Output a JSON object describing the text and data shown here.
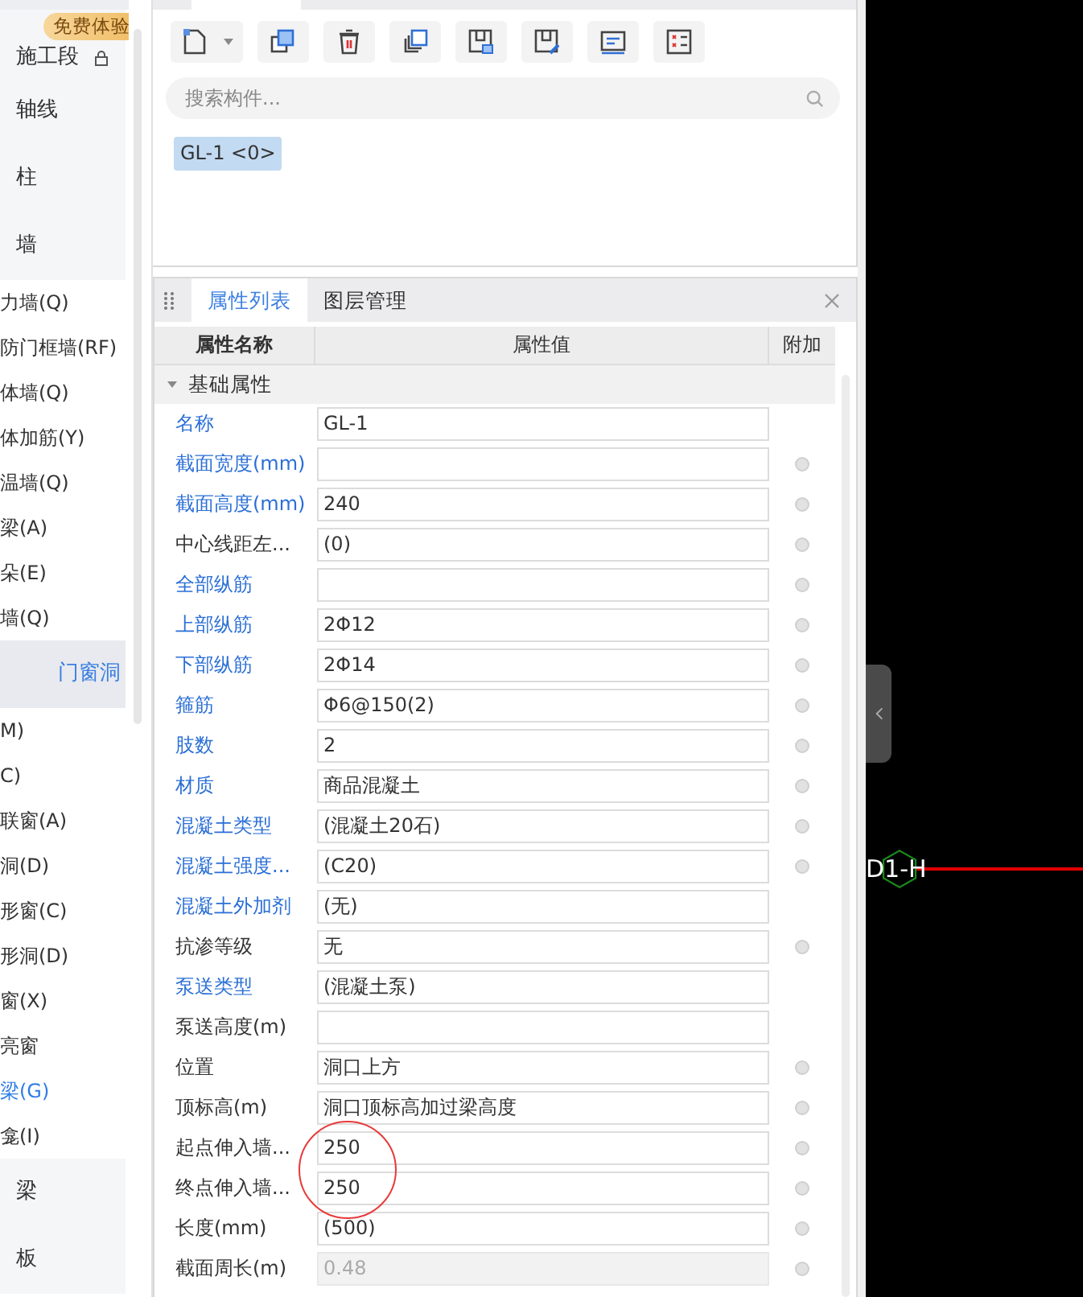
{
  "sidebar": {
    "badge": "免费体验",
    "items": [
      {
        "label": "施工段",
        "selected": false,
        "locked": true
      },
      {
        "label": "轴线",
        "selected": false
      },
      {
        "label": "柱",
        "selected": false
      },
      {
        "label": "墙",
        "selected": false,
        "children": [
          {
            "label": "力墙(Q)",
            "selected": false
          },
          {
            "label": "防门框墙(RF)",
            "selected": false
          },
          {
            "label": "体墙(Q)",
            "selected": false
          },
          {
            "label": "体加筋(Y)",
            "selected": false
          },
          {
            "label": "温墙(Q)",
            "selected": false
          },
          {
            "label": "梁(A)",
            "selected": false
          },
          {
            "label": "朵(E)",
            "selected": false
          },
          {
            "label": "墙(Q)",
            "selected": false
          }
        ]
      },
      {
        "label": "门窗洞",
        "selected": true,
        "children": [
          {
            "label": "M)",
            "selected": false
          },
          {
            "label": "C)",
            "selected": false
          },
          {
            "label": "联窗(A)",
            "selected": false
          },
          {
            "label": "洞(D)",
            "selected": false
          },
          {
            "label": "形窗(C)",
            "selected": false
          },
          {
            "label": "形洞(D)",
            "selected": false
          },
          {
            "label": "窗(X)",
            "selected": false
          },
          {
            "label": "亮窗",
            "selected": false
          },
          {
            "label": "梁(G)",
            "selected": true
          },
          {
            "label": "龛(I)",
            "selected": false
          }
        ]
      },
      {
        "label": "梁",
        "selected": false
      },
      {
        "label": "板",
        "selected": false
      }
    ]
  },
  "component_list": {
    "search": {
      "placeholder": "搜索构件..."
    },
    "components": [
      {
        "label": "GL-1 <0>",
        "selected": true
      }
    ]
  },
  "properties": {
    "tabs": [
      {
        "label": "属性列表",
        "selected": true
      },
      {
        "label": "图层管理",
        "selected": false
      }
    ],
    "columns": [
      "属性名称",
      "属性值",
      "附加"
    ],
    "group": {
      "label": "基础属性",
      "expanded": true
    },
    "rows": [
      {
        "name": "名称",
        "public": true,
        "value": "GL-1",
        "attach": false,
        "disabled": false
      },
      {
        "name": "截面宽度(mm)",
        "public": true,
        "attach": true,
        "disabled": false
      },
      {
        "name": "截面高度(mm)",
        "public": true,
        "value": "240",
        "attach": true,
        "disabled": false
      },
      {
        "name": "中心线距左...",
        "public": false,
        "value": "(0)",
        "attach": true,
        "disabled": false
      },
      {
        "name": "全部纵筋",
        "public": true,
        "attach": true,
        "disabled": false
      },
      {
        "name": "上部纵筋",
        "public": true,
        "value": "2Φ12",
        "attach": true,
        "disabled": false
      },
      {
        "name": "下部纵筋",
        "public": true,
        "value": "2Φ14",
        "attach": true,
        "disabled": false
      },
      {
        "name": "箍筋",
        "public": true,
        "value": "Φ6@150(2)",
        "attach": true,
        "disabled": false
      },
      {
        "name": "肢数",
        "public": true,
        "value": "2",
        "attach": true,
        "disabled": false
      },
      {
        "name": "材质",
        "public": true,
        "value": "商品混凝土",
        "attach": true,
        "disabled": false
      },
      {
        "name": "混凝土类型",
        "public": true,
        "value": "(混凝土20石)",
        "attach": true,
        "disabled": false
      },
      {
        "name": "混凝土强度...",
        "public": true,
        "value": "(C20)",
        "attach": true,
        "disabled": false
      },
      {
        "name": "混凝土外加剂",
        "public": true,
        "value": "(无)",
        "attach": false,
        "disabled": false
      },
      {
        "name": "抗渗等级",
        "public": false,
        "value": "无",
        "attach": true,
        "disabled": false
      },
      {
        "name": "泵送类型",
        "public": true,
        "value": "(混凝土泵)",
        "attach": false,
        "disabled": false
      },
      {
        "name": "泵送高度(m)",
        "public": false,
        "attach": false,
        "disabled": false
      },
      {
        "name": "位置",
        "public": false,
        "value": "洞口上方",
        "attach": true,
        "disabled": false
      },
      {
        "name": "顶标高(m)",
        "public": false,
        "value": "洞口顶标高加过梁高度",
        "attach": true,
        "disabled": false
      },
      {
        "name": "起点伸入墙...",
        "public": false,
        "value": "250",
        "attach": true,
        "disabled": false
      },
      {
        "name": "终点伸入墙...",
        "public": false,
        "value": "250",
        "attach": true,
        "disabled": false
      },
      {
        "name": "长度(mm)",
        "public": false,
        "value": "(500)",
        "attach": true,
        "disabled": false
      },
      {
        "name": "截面周长(m)",
        "public": false,
        "value": "0.48",
        "attach": true,
        "disabled": true
      }
    ]
  },
  "canvas": {
    "axis_label": "D1-H"
  }
}
